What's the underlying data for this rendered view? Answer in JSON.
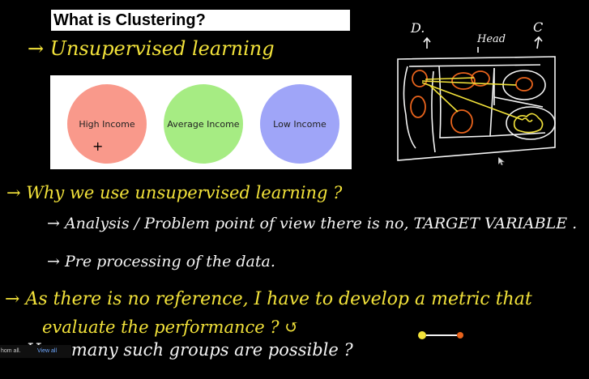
{
  "title": "What is Clustering?",
  "notes": {
    "line1": "→ Unsupervised learning",
    "line2": "→ Why we use unsupervised learning ?",
    "line3": "→ Analysis / Problem point of view there is no, TARGET VARIABLE .",
    "line4": "→ Pre processing of the data.",
    "line5": "→ As there is no reference, I have to develop a metric that",
    "line6": "evaluate the performance ? ↺",
    "line7": "→ How many such groups are possible ?"
  },
  "clusters": [
    {
      "label": "High Income",
      "color": "#f9998b"
    },
    {
      "label": "Average Income",
      "color": "#a6ec83"
    },
    {
      "label": "Low Income",
      "color": "#9fa5f8"
    }
  ],
  "sketch": {
    "label_d": "D.",
    "label_head": "Head",
    "label_c": "C"
  },
  "notification": {
    "left_text": "hom all.",
    "action": "View all"
  },
  "colors": {
    "ink_yellow": "#f2e23a",
    "ink_white": "#f4f4f4",
    "ink_orange": "#e8631c",
    "background": "#000000"
  }
}
